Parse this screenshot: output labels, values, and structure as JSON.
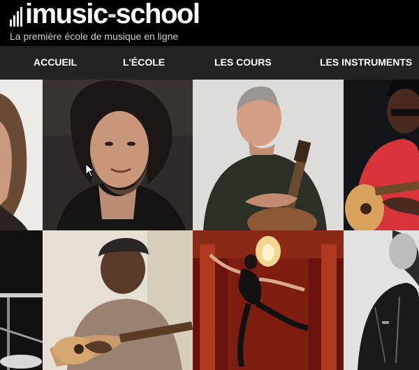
{
  "header": {
    "logo_main": "imusic",
    "logo_accent": "-",
    "logo_end": "school",
    "tagline": "La première école de musique en ligne"
  },
  "nav": {
    "items": [
      "ACCUEIL",
      "L'ÉCOLE",
      "LES COURS",
      "LES INSTRUMENTS"
    ]
  },
  "gallery": {
    "tiles": [
      {
        "name": "teacher-photo-woman-long-hair"
      },
      {
        "name": "teacher-photo-man-curly-hair"
      },
      {
        "name": "teacher-photo-man-with-acoustic-guitar"
      },
      {
        "name": "teacher-photo-man-red-shirt-guitar"
      },
      {
        "name": "teacher-photo-microphone-stand"
      },
      {
        "name": "teacher-photo-woman-beanie-guitar"
      },
      {
        "name": "teacher-photo-dancer-chandelier"
      },
      {
        "name": "teacher-photo-leather-jacket"
      }
    ]
  },
  "colors": {
    "header_bg": "#000000",
    "nav_bg": "#222325",
    "nav_text": "#ffffff",
    "logo_accent": "#cfd6cc"
  }
}
